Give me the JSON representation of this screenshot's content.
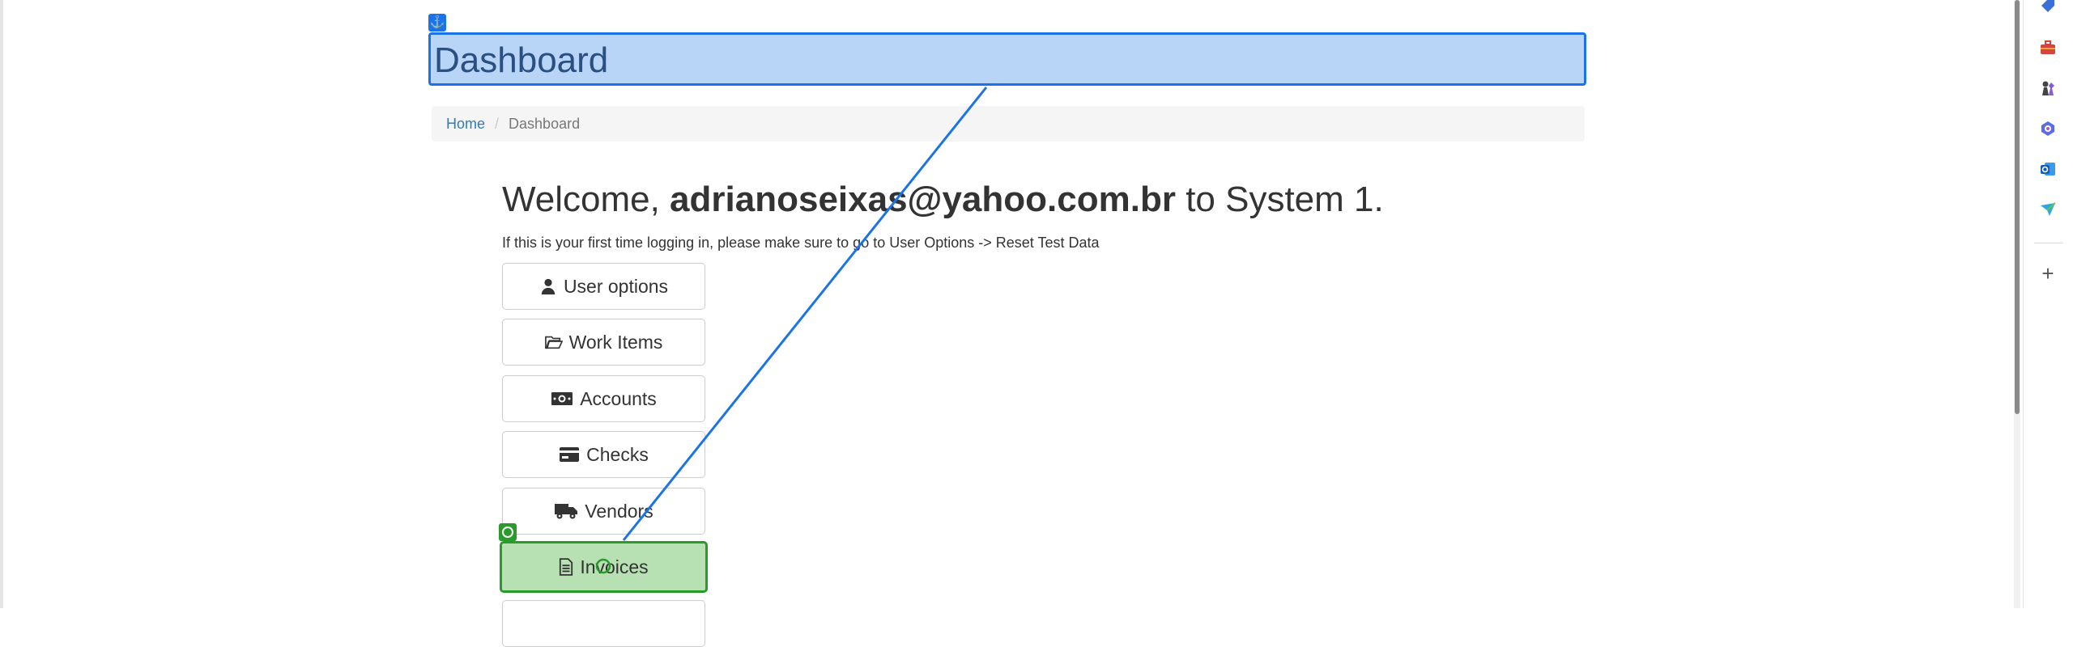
{
  "page": {
    "title": "Dashboard"
  },
  "breadcrumb": {
    "home": "Home",
    "separator": "/",
    "current": "Dashboard"
  },
  "welcome": {
    "prefix": "Welcome,",
    "user": "adrianoseixas@yahoo.com.br",
    "suffix": "to System 1.",
    "hint": "If this is your first time logging in, please make sure to go to User Options -> Reset Test Data"
  },
  "menu": [
    {
      "label": "User options",
      "icon": "user-icon"
    },
    {
      "label": "Work Items",
      "icon": "folder-open-icon"
    },
    {
      "label": "Accounts",
      "icon": "money-bill-icon"
    },
    {
      "label": "Checks",
      "icon": "credit-card-icon"
    },
    {
      "label": "Vendors",
      "icon": "truck-icon"
    },
    {
      "label": "Invoices",
      "icon": "file-text-icon",
      "highlighted": true
    }
  ],
  "annotation": {
    "anchor_icon": "anchor-icon",
    "target_icon": "target-icon",
    "anchor_color": "#1a73e8",
    "target_color": "#2a9a2a"
  },
  "sidebar": {
    "icons": [
      "tag-icon",
      "briefcase-icon",
      "chess-icon",
      "copilot-icon",
      "outlook-icon",
      "send-icon"
    ],
    "add_label": "+"
  }
}
